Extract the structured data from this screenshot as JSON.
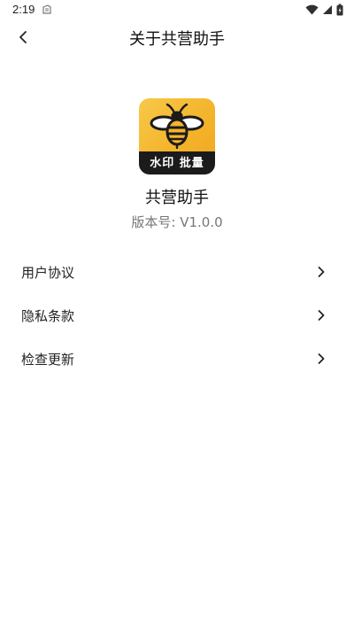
{
  "status_bar": {
    "time": "2:19",
    "icons": [
      "notification-icon",
      "wifi-icon",
      "signal-icon",
      "battery-icon"
    ]
  },
  "header": {
    "title": "关于共营助手",
    "back_icon": "back-arrow-icon"
  },
  "app": {
    "icon_banner_text": "水印 批量",
    "name": "共营助手",
    "version": "版本号: V1.0.0"
  },
  "menu": {
    "items": [
      {
        "label": "用户协议",
        "icon": "chevron-right-icon"
      },
      {
        "label": "隐私条款",
        "icon": "chevron-right-icon"
      },
      {
        "label": "检查更新",
        "icon": "chevron-right-icon"
      }
    ]
  },
  "colors": {
    "background": "#ffffff",
    "icon_yellow": "#f4b42c",
    "icon_dark": "#1b1b1b",
    "secondary_text": "#777777"
  }
}
